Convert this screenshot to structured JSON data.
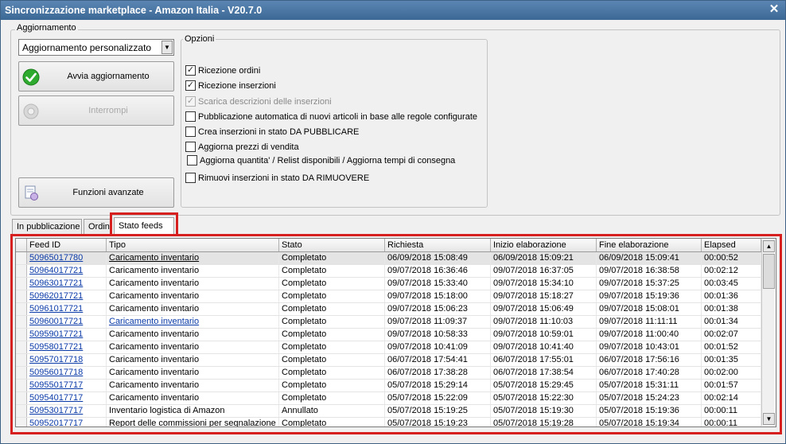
{
  "window": {
    "title": "Sincronizzazione marketplace - Amazon Italia - V20.7.0",
    "close": "✕"
  },
  "aggiornamento": {
    "legend": "Aggiornamento",
    "mode_value": "Aggiornamento personalizzato",
    "start_label": "Avvia aggiornamento",
    "stop_label": "Interrompi",
    "advanced_label": "Funzioni avanzate"
  },
  "options": {
    "legend": "Opzioni",
    "items": [
      {
        "label": "Ricezione ordini",
        "checked": true,
        "disabled": false
      },
      {
        "label": "Ricezione inserzioni",
        "checked": true,
        "disabled": false
      },
      {
        "label": "Scarica descrizioni delle inserzioni",
        "checked": true,
        "disabled": true
      },
      {
        "label": "Pubblicazione automatica di nuovi articoli in base alle regole configurate",
        "checked": false,
        "disabled": false
      },
      {
        "label": "Crea inserzioni in stato DA PUBBLICARE",
        "checked": false,
        "disabled": false
      },
      {
        "label": "Aggiorna prezzi di vendita",
        "checked": false,
        "disabled": false
      },
      {
        "label": "Aggiorna quantita' / Relist disponibili / Aggiorna tempi di consegna",
        "checked": false,
        "disabled": false
      },
      {
        "label": "Rimuovi inserzioni in stato DA RIMUOVERE",
        "checked": false,
        "disabled": false
      }
    ]
  },
  "tabs": [
    "In pubblicazione",
    "Ordini",
    "Stato feeds"
  ],
  "grid": {
    "columns": [
      "Feed ID",
      "Tipo",
      "Stato",
      "Richiesta",
      "Inizio elaborazione",
      "Fine elaborazione",
      "Elapsed"
    ],
    "rows": [
      [
        "50965017780",
        "Caricamento inventario",
        "Completato",
        "06/09/2018 15:08:49",
        "06/09/2018 15:09:21",
        "06/09/2018 15:09:41",
        "00:00:52"
      ],
      [
        "50964017721",
        "Caricamento inventario",
        "Completato",
        "09/07/2018 16:36:46",
        "09/07/2018 16:37:05",
        "09/07/2018 16:38:58",
        "00:02:12"
      ],
      [
        "50963017721",
        "Caricamento inventario",
        "Completato",
        "09/07/2018 15:33:40",
        "09/07/2018 15:34:10",
        "09/07/2018 15:37:25",
        "00:03:45"
      ],
      [
        "50962017721",
        "Caricamento inventario",
        "Completato",
        "09/07/2018 15:18:00",
        "09/07/2018 15:18:27",
        "09/07/2018 15:19:36",
        "00:01:36"
      ],
      [
        "50961017721",
        "Caricamento inventario",
        "Completato",
        "09/07/2018 15:06:23",
        "09/07/2018 15:06:49",
        "09/07/2018 15:08:01",
        "00:01:38"
      ],
      [
        "50960017721",
        "Caricamento inventario",
        "Completato",
        "09/07/2018 11:09:37",
        "09/07/2018 11:10:03",
        "09/07/2018 11:11:11",
        "00:01:34"
      ],
      [
        "50959017721",
        "Caricamento inventario",
        "Completato",
        "09/07/2018 10:58:33",
        "09/07/2018 10:59:01",
        "09/07/2018 11:00:40",
        "00:02:07"
      ],
      [
        "50958017721",
        "Caricamento inventario",
        "Completato",
        "09/07/2018 10:41:09",
        "09/07/2018 10:41:40",
        "09/07/2018 10:43:01",
        "00:01:52"
      ],
      [
        "50957017718",
        "Caricamento inventario",
        "Completato",
        "06/07/2018 17:54:41",
        "06/07/2018 17:55:01",
        "06/07/2018 17:56:16",
        "00:01:35"
      ],
      [
        "50956017718",
        "Caricamento inventario",
        "Completato",
        "06/07/2018 17:38:28",
        "06/07/2018 17:38:54",
        "06/07/2018 17:40:28",
        "00:02:00"
      ],
      [
        "50955017717",
        "Caricamento inventario",
        "Completato",
        "05/07/2018 15:29:14",
        "05/07/2018 15:29:45",
        "05/07/2018 15:31:11",
        "00:01:57"
      ],
      [
        "50954017717",
        "Caricamento inventario",
        "Completato",
        "05/07/2018 15:22:09",
        "05/07/2018 15:22:30",
        "05/07/2018 15:24:23",
        "00:02:14"
      ],
      [
        "50953017717",
        "Inventario logistica di Amazon",
        "Annullato",
        "05/07/2018 15:19:25",
        "05/07/2018 15:19:30",
        "05/07/2018 15:19:36",
        "00:00:11"
      ],
      [
        "50952017717",
        "Report delle commissioni per segnalazione",
        "Completato",
        "05/07/2018 15:19:23",
        "05/07/2018 15:19:28",
        "05/07/2018 15:19:34",
        "00:00:11"
      ]
    ]
  }
}
